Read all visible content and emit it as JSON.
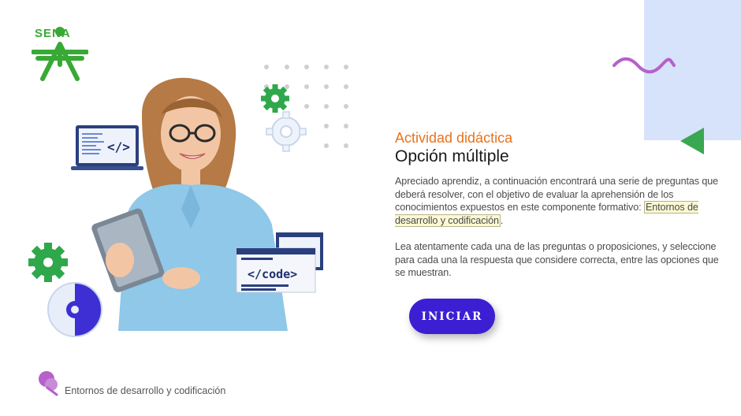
{
  "brand": {
    "logo_text": "SENA"
  },
  "activity": {
    "subtitle": "Actividad didáctica",
    "title": "Opción múltiple",
    "intro_text": "Apreciado aprendiz, a continuación encontrará una serie de preguntas que deberá resolver, con el objetivo de evaluar la aprehensión de los conocimientos expuestos en este componente formativo:",
    "component_name": "Entornos de desarrollo y codificación",
    "instructions": "Lea atentamente cada una de las preguntas o proposiciones, y seleccione para cada una la respuesta que considere correcta, entre las opciones que se muestran."
  },
  "start_button": {
    "label": "INICIAR"
  },
  "footer": {
    "label": "Entornos de desarrollo y codificación"
  },
  "illustration": {
    "code_tag_laptop": "</>",
    "code_tag_window": "</code>"
  },
  "colors": {
    "accent_orange": "#e8731c",
    "button_blue": "#3d1fd3",
    "sena_green": "#39a935",
    "panel_blue": "#d6e3fb",
    "wave_purple": "#b561c9"
  }
}
